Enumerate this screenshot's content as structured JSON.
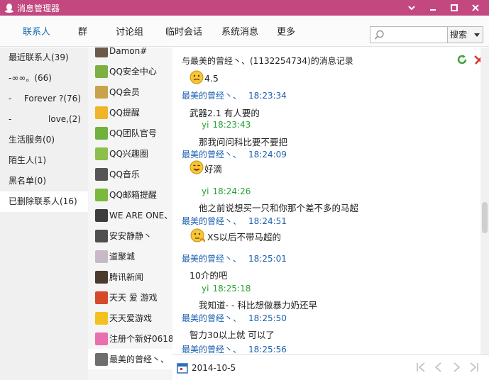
{
  "window": {
    "title": "消息管理器"
  },
  "tabs": [
    "联系人",
    "群",
    "讨论组",
    "临时会话",
    "系统消息",
    "更多"
  ],
  "search": {
    "placeholder": "",
    "button_label": "搜索"
  },
  "categories": [
    {
      "label": "最近联系人(39)"
    },
    {
      "label": "-∞∞。(66)"
    },
    {
      "label": "-",
      "right": "Forever ?(76)"
    },
    {
      "label": "-",
      "right": "love,(2)"
    },
    {
      "label": "生活服务(0)"
    },
    {
      "label": "陌生人(1)"
    },
    {
      "label": "黑名单(0)"
    },
    {
      "label": "已删除联系人(16)"
    }
  ],
  "contacts": [
    {
      "name": "Damon#",
      "color": "#6b5a4a"
    },
    {
      "name": "QQ安全中心",
      "color": "#7db043"
    },
    {
      "name": "QQ会员",
      "color": "#c9a349"
    },
    {
      "name": "QQ提醒",
      "color": "#f0b429"
    },
    {
      "name": "QQ团队官号",
      "color": "#6fb33c"
    },
    {
      "name": "QQ兴趣圈",
      "color": "#8cc04b"
    },
    {
      "name": "QQ音乐",
      "color": "#555555"
    },
    {
      "name": "QQ邮箱提醒",
      "color": "#7ab83e"
    },
    {
      "name": "WE ARE ONE、",
      "color": "#3d3d3d"
    },
    {
      "name": "安安静静丶",
      "color": "#4f4f4f"
    },
    {
      "name": "道聚城",
      "color": "#c8b9c9"
    },
    {
      "name": "腾讯新闻",
      "color": "#4a3b2c"
    },
    {
      "name": "天天 爱 游戏",
      "color": "#d44a2a"
    },
    {
      "name": "天天爱游戏",
      "color": "#f2c11e"
    },
    {
      "name": "注册个新好0618",
      "color": "#e96fae"
    },
    {
      "name": "最美的曾经丶、",
      "color": "#6e6e6e"
    }
  ],
  "messages": {
    "header": "与最美的曾经丶、(1132254734)的消息记录",
    "lines": [
      {
        "kind": "text",
        "emoji": "sad",
        "text": "4.5"
      },
      {
        "kind": "sender",
        "name": "最美的曾经丶、",
        "time": "18:23:34"
      },
      {
        "kind": "text",
        "text": "武器2.1 有人要的"
      },
      {
        "kind": "me",
        "name": "yi",
        "time": "18:23:43"
      },
      {
        "kind": "text",
        "text": "那我问问科比要不要把"
      },
      {
        "kind": "sender",
        "name": "最美的曾经丶、",
        "time": "18:24:09"
      },
      {
        "kind": "text",
        "emoji": "smile",
        "text": "好滴"
      },
      {
        "kind": "me",
        "name": "yi",
        "time": "18:24:26"
      },
      {
        "kind": "text",
        "text": "他之前说想买一只和你那个差不多的马超"
      },
      {
        "kind": "sender",
        "name": "最美的曾经丶、",
        "time": "18:24:51"
      },
      {
        "kind": "text",
        "emoji": "think",
        "text": "XS以后不带马超的"
      },
      {
        "kind": "sender",
        "name": "最美的曾经丶、",
        "time": "18:25:01"
      },
      {
        "kind": "text",
        "text": "10介的吧"
      },
      {
        "kind": "me",
        "name": "yi",
        "time": "18:25:18"
      },
      {
        "kind": "text",
        "text": "我知道- -   科比想做暴力奶还早"
      },
      {
        "kind": "sender",
        "name": "最美的曾经丶、",
        "time": "18:25:50"
      },
      {
        "kind": "text",
        "text": "智力30以上就 可以了"
      },
      {
        "kind": "sender",
        "name": "最美的曾经丶、",
        "time": "18:25:56"
      }
    ]
  },
  "footer": {
    "date": "2014-10-5"
  }
}
